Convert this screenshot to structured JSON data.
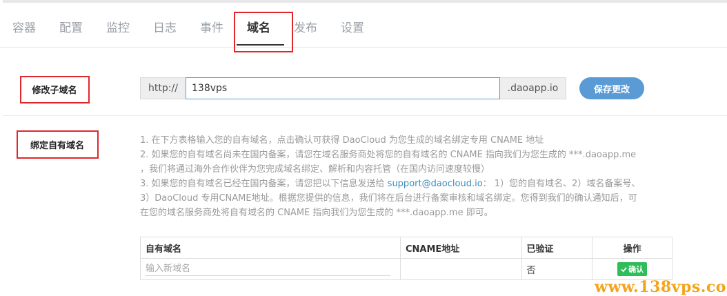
{
  "tabs": [
    {
      "label": "容器"
    },
    {
      "label": "配置"
    },
    {
      "label": "监控"
    },
    {
      "label": "日志"
    },
    {
      "label": "事件"
    },
    {
      "label": "域名"
    },
    {
      "label": "发布"
    },
    {
      "label": "设置"
    }
  ],
  "active_tab": "域名",
  "subdomain": {
    "label": "修改子域名",
    "prefix": "http://",
    "value": "138vps",
    "suffix": ".daoapp.io",
    "save_label": "保存更改"
  },
  "custom_domain": {
    "label": "绑定自有域名",
    "instructions": {
      "line1": "1. 在下方表格输入您的自有域名，点击确认可获得 DaoCloud 为您生成的域名绑定专用 CNAME 地址",
      "line2": "2. 如果您的自有域名尚未在国内备案，请您在域名服务商处将您的自有域名的 CNAME 指向我们为您生成的 ***.daoapp.me",
      "line3": "，我们将通过海外合作伙伴为您完成域名绑定、解析和内容托管（在国内访问速度较慢）",
      "line4_before": "3. 如果您的自有域名已经在国内备案，请您把以下信息发送给 ",
      "email": "support@daocloud.io",
      "line4_after": "： 1）您的自有域名、2）域名备案号、",
      "line5": "3）DaoCloud 专用CNAME地址。根据您提供的信息，我们将在后台进行备案审核和域名绑定。您得到我们的确认通知后，可",
      "line6": "在您的域名服务商处将自有域名的 CNAME 指向我们为您生成的 ***.daoapp.me 即可。"
    },
    "table": {
      "headers": [
        "自有域名",
        "CNAME地址",
        "已验证",
        "操作"
      ],
      "row": {
        "domain_placeholder": "输入新域名",
        "cname": "",
        "verified": "否",
        "action_label": "确认",
        "action_icon": "check-icon"
      }
    }
  },
  "watermark": "www.138vps.com",
  "colors": {
    "highlight": "#e0262a",
    "primary": "#5b9bd5",
    "confirm": "#2fbd5a",
    "watermark": "#f5a31a"
  }
}
